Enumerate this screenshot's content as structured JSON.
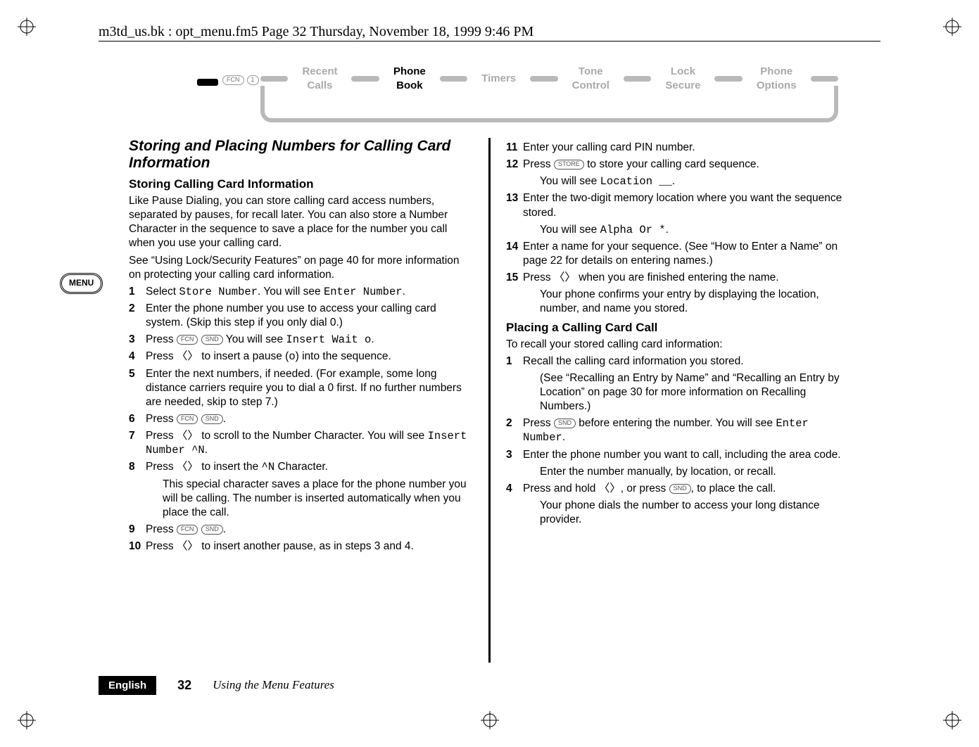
{
  "header_line": "m3td_us.bk : opt_menu.fm5  Page 32  Thursday, November 18, 1999  9:46 PM",
  "nav": {
    "icon_labels": [
      "FCN",
      "1"
    ],
    "items": [
      {
        "l1": "Recent",
        "l2": "Calls",
        "active": false
      },
      {
        "l1": "Phone",
        "l2": "Book",
        "active": true
      },
      {
        "l1": "Timers",
        "l2": "",
        "active": false
      },
      {
        "l1": "Tone",
        "l2": "Control",
        "active": false
      },
      {
        "l1": "Lock",
        "l2": "Secure",
        "active": false
      },
      {
        "l1": "Phone",
        "l2": "Options",
        "active": false
      }
    ]
  },
  "menu_badge": "MENU",
  "left": {
    "heading": "Storing and Placing Numbers for Calling Card Information",
    "sub1": "Storing Calling Card Information",
    "p1": "Like Pause Dialing, you can store calling card access numbers, separated by pauses, for recall later. You can also store a Number Character in the sequence to save a place for the number you call when you use your calling card.",
    "p2": "See “Using Lock/Security Features” on page 40 for more information on protecting your calling card information.",
    "s1a": "Select ",
    "s1_pix1": "Store Number",
    "s1b": ". You will see ",
    "s1_pix2": "Enter Number",
    "s1c": ".",
    "s2": "Enter the phone number you use to access your calling card system. (Skip this step if you only dial 0.)",
    "s3a": "Press ",
    "s3_btn1": "FCN",
    "s3_btn2": "SND",
    "s3b": "  You will see ",
    "s3_pix": "Insert Wait o",
    "s3c": ".",
    "s4a": "Press 〈〉 to insert a pause (",
    "s4_pix": "o",
    "s4b": ") into the sequence.",
    "s5": "Enter the next numbers, if needed. (For example, some long distance carriers require you to dial a 0 first. If no further numbers are needed, skip to step 7.)",
    "s6a": "Press ",
    "s6_btn1": "FCN",
    "s6_btn2": "SND",
    "s6b": ".",
    "s7a": "Press 〈〉 to scroll to the Number Character. You will see ",
    "s7_pix": "Insert Number ^N",
    "s7b": ".",
    "s8a": "Press 〈〉 to insert the ",
    "s8_pix": "^N",
    "s8b": " Character.",
    "s8_sub": "This special character saves a place for the phone number you will be calling. The number is inserted automatically when you place the call.",
    "s9a": "Press ",
    "s9_btn1": "FCN",
    "s9_btn2": "SND",
    "s9b": ".",
    "s10": "Press 〈〉 to insert another pause, as in steps 3 and 4."
  },
  "right": {
    "s11": "Enter your calling card PIN number.",
    "s12a": "Press ",
    "s12_btn": "STORE",
    "s12b": " to store your calling card sequence.",
    "s12_sub_a": "You will see ",
    "s12_sub_pix": "Location __",
    "s12_sub_b": ".",
    "s13": "Enter the two-digit memory location where you want the sequence stored.",
    "s13_sub_a": "You will see ",
    "s13_sub_pix": "Alpha Or *",
    "s13_sub_b": ".",
    "s14": "Enter a name for your sequence. (See “How to Enter a Name” on page 22 for details on entering names.)",
    "s15": "Press 〈〉 when you are finished entering the name.",
    "s15_sub": "Your phone confirms your entry by displaying the location, number, and name you stored.",
    "sub2": "Placing a Calling Card Call",
    "p3": "To recall your stored calling card information:",
    "r1": "Recall the calling card information you stored.",
    "r1_sub": "(See “Recalling an Entry by Name”  and “Recalling an Entry by Location” on page 30 for more information on Recalling Numbers.)",
    "r2a": "Press ",
    "r2_btn": "SND",
    "r2b": " before entering the number. You will see ",
    "r2_pix": "Enter Number",
    "r2c": ".",
    "r3": "Enter the phone number you want to call, including the area code.",
    "r3_sub": "Enter the number manually, by location, or recall.",
    "r4a": "Press and hold 〈〉, or press ",
    "r4_btn": "SND",
    "r4b": ", to place the call.",
    "r4_sub": "Your phone dials the number to access your long distance provider."
  },
  "footer": {
    "lang": "English",
    "page_number": "32",
    "chapter": "Using the Menu Features"
  }
}
